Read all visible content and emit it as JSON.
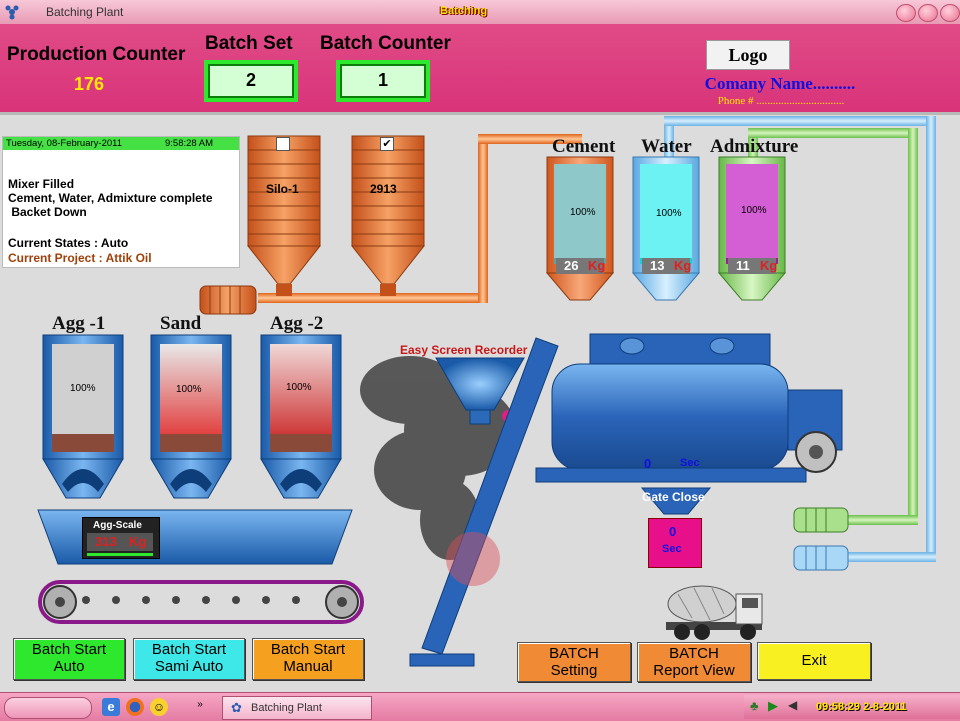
{
  "window": {
    "title": "Batching Plant",
    "center_title": "Batching"
  },
  "header": {
    "production_counter_label": "Production Counter",
    "production_counter_value": "176",
    "batch_set_label": "Batch Set",
    "batch_set_value": "2",
    "batch_counter_label": "Batch Counter",
    "batch_counter_value": "1",
    "logo": "Logo",
    "company_name": "Comany Name..........",
    "phone": "Phone # ................................"
  },
  "status": {
    "date": "Tuesday, 08-February-2011",
    "time": "9:58:28 AM",
    "lines": [
      "Mixer Filled",
      "Cement, Water, Admixture complete",
      " Backet Down"
    ],
    "current_states": "Current States : Auto",
    "current_project": "Current Project : Attik Oil"
  },
  "silos": {
    "silo1_label": "Silo-1",
    "silo2_label": "2913"
  },
  "tanks": [
    {
      "name": "Cement",
      "percent": "100%",
      "value": "26",
      "unit": "Kg"
    },
    {
      "name": "Water",
      "percent": "100%",
      "value": "13",
      "unit": "Kg"
    },
    {
      "name": "Admixture",
      "percent": "100%",
      "value": "11",
      "unit": "Kg"
    }
  ],
  "bins": [
    {
      "name": "Agg -1",
      "percent": "100%"
    },
    {
      "name": "Sand",
      "percent": "100%"
    },
    {
      "name": "Agg -2",
      "percent": "100%"
    }
  ],
  "agg_scale": {
    "label": "Agg-Scale",
    "value": "313",
    "unit": "Kg"
  },
  "mixer": {
    "timer_value": "0",
    "timer_unit": "Sec",
    "gate_label": "Gate Close",
    "gate_value": "0",
    "gate_unit": "Sec"
  },
  "watermark": "Easy Screen Recorder",
  "buttons": {
    "batch_start_auto": "Batch Start\nAuto",
    "batch_start_semi": "Batch Start\nSami Auto",
    "batch_start_manual": "Batch Start\nManual",
    "batch_setting": "BATCH\nSetting",
    "batch_report": "BATCH\nReport View",
    "exit": "Exit"
  },
  "taskbar": {
    "task_label": "Batching Plant",
    "clock": "09:58:29 2-8-2011"
  },
  "colors": {
    "header": "#d9337a",
    "counter_border": "#2ee82e",
    "silo": "#e8772e",
    "pipe_blue": "#6ab2e6",
    "pipe_green": "#6cc04c"
  }
}
